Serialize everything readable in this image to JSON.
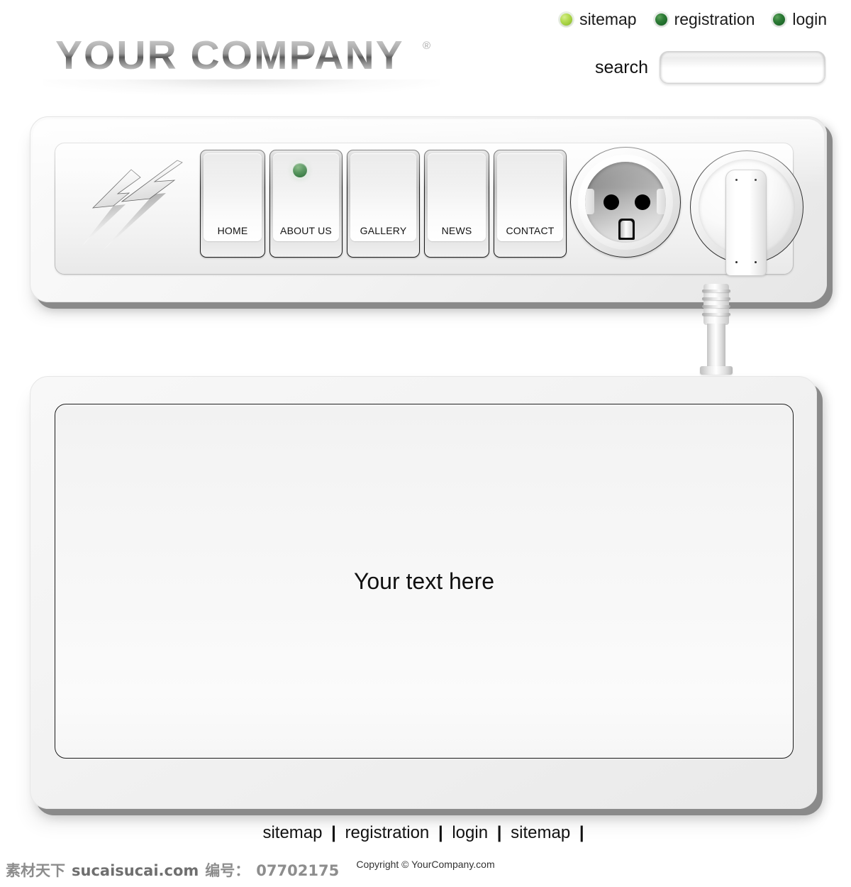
{
  "header": {
    "logo_text": "YOUR COMPANY",
    "logo_trademark": "®",
    "top_links": [
      {
        "label": "sitemap",
        "dot_color": "#b6dd54",
        "dot_style": "light-green"
      },
      {
        "label": "registration",
        "dot_color": "#2d7c36",
        "dot_style": "dark-green"
      },
      {
        "label": "login",
        "dot_color": "#2d7c36",
        "dot_style": "dark-green"
      }
    ],
    "search": {
      "label": "search",
      "value": "",
      "placeholder": ""
    }
  },
  "nav": {
    "brand_icon": "lightning-bolts-icon",
    "items": [
      {
        "label": "HOME",
        "active": false
      },
      {
        "label": "ABOUT US",
        "active": true
      },
      {
        "label": "GALLERY",
        "active": false
      },
      {
        "label": "NEWS",
        "active": false
      },
      {
        "label": "CONTACT",
        "active": false
      }
    ],
    "active_led_color": "#2f7d38",
    "socket_icon": "power-socket-icon",
    "plug_icon": "power-plug-icon",
    "cable_icon": "power-cable-icon"
  },
  "main": {
    "content_text": "Your text here"
  },
  "footer": {
    "links": [
      "sitemap",
      "registration",
      "login",
      "sitemap"
    ],
    "separator": "|",
    "copyright": "Copyright © YourCompany.com"
  },
  "watermark": {
    "brand_cn": "素材天下",
    "site": "sucaisucai.com",
    "id_label": "编号：",
    "id_value": "07702175"
  }
}
